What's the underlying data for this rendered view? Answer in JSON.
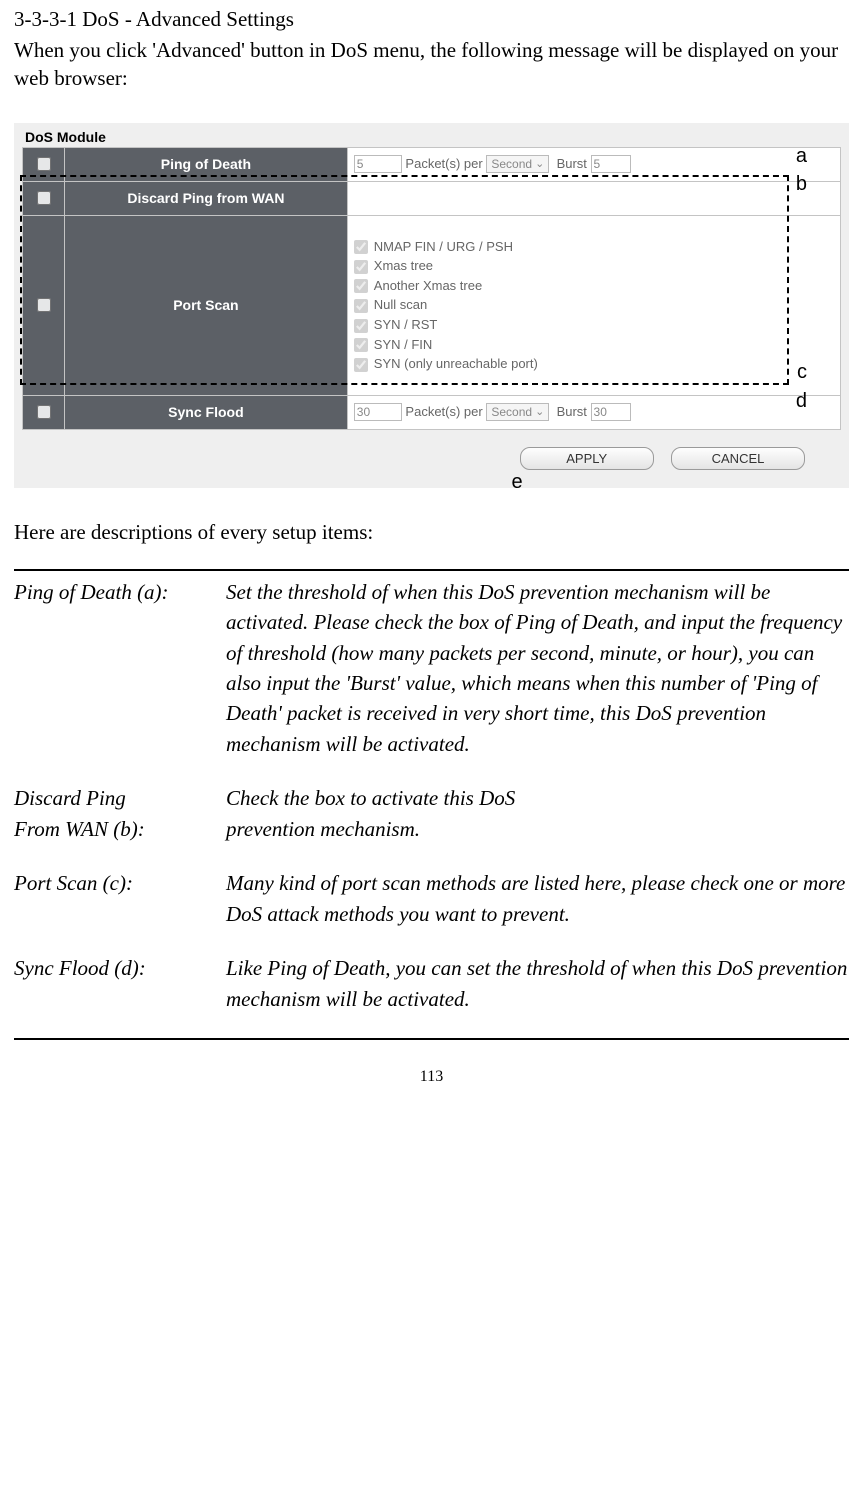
{
  "heading": "3-3-3-1 DoS - Advanced Settings",
  "intro": "When you click 'Advanced' button in DoS menu, the following message will be displayed on your web browser:",
  "module": {
    "title": "DoS Module",
    "rows": {
      "pod": {
        "label": "Ping of Death",
        "packets": "5",
        "packets_per_text": "Packet(s) per",
        "unit": "Second",
        "burst_label": "Burst",
        "burst": "5"
      },
      "discard": {
        "label": "Discard Ping from WAN"
      },
      "portscan": {
        "label": "Port Scan",
        "options": [
          "NMAP FIN / URG / PSH",
          "Xmas tree",
          "Another Xmas tree",
          "Null scan",
          "SYN / RST",
          "SYN / FIN",
          "SYN (only unreachable port)"
        ]
      },
      "sync": {
        "label": "Sync Flood",
        "packets": "30",
        "packets_per_text": "Packet(s) per",
        "unit": "Second",
        "burst_label": "Burst",
        "burst": "30"
      }
    },
    "buttons": {
      "apply": "APPLY",
      "cancel": "CANCEL"
    }
  },
  "annotations": {
    "a": "a",
    "b": "b",
    "c": "c",
    "d": "d",
    "e": "e"
  },
  "desc_intro": "Here are descriptions of every setup items:",
  "descriptions": {
    "pod": {
      "label": "Ping of Death (a):",
      "text": "Set the threshold of when this DoS prevention mechanism will be activated. Please check the box of Ping of Death, and input the frequency of threshold (how many packets per second, minute, or hour), you can also input the 'Burst' value, which means when this number of 'Ping of Death' packet is received in very short time, this DoS prevention mechanism will be activated."
    },
    "discard": {
      "label1": "Discard Ping",
      "label2": "From WAN (b):",
      "text1": "Check the box to activate this DoS",
      "text2": "prevention mechanism."
    },
    "portscan": {
      "label": "Port Scan (c):",
      "text": "Many kind of port scan methods are listed here, please check one or more DoS attack methods you want to prevent."
    },
    "sync": {
      "label": "Sync Flood (d):",
      "text": "Like Ping of Death, you can set the threshold of when this DoS prevention mechanism will be activated."
    }
  },
  "page_number": "113"
}
